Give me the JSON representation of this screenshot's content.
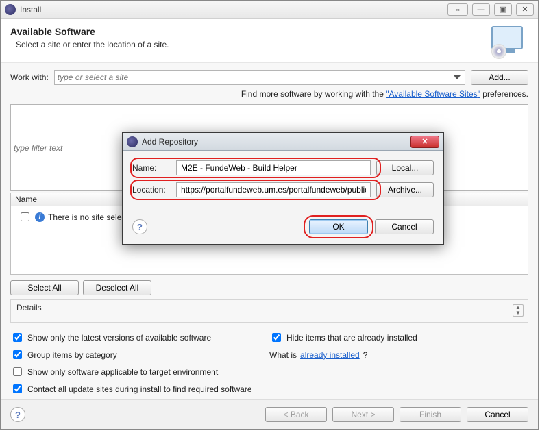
{
  "window": {
    "title": "Install",
    "controls": {
      "detach": "⇔",
      "min": "—",
      "max": "▣",
      "close": "✕"
    }
  },
  "header": {
    "title": "Available Software",
    "subtitle": "Select a site or enter the location of a site."
  },
  "workwith": {
    "label": "Work with:",
    "placeholder": "type or select a site",
    "add_label": "Add..."
  },
  "hint": {
    "prefix": "Find more software by working with the ",
    "link": "Available Software Sites",
    "suffix": " preferences."
  },
  "filter_placeholder": "type filter text",
  "tree": {
    "column": "Name",
    "empty_msg": "There is no site selected."
  },
  "tree_buttons": {
    "select_all": "Select All",
    "deselect_all": "Deselect All"
  },
  "details_label": "Details",
  "options": {
    "latest": "Show only the latest versions of available software",
    "hide_installed": "Hide items that are already installed",
    "group": "Group items by category",
    "whatis_prefix": "What is ",
    "whatis_link": "already installed",
    "applicable": "Show only software applicable to target environment",
    "contact_all": "Contact all update sites during install to find required software"
  },
  "option_states": {
    "latest": true,
    "hide_installed": true,
    "group": true,
    "applicable": false,
    "contact_all": true
  },
  "wizard": {
    "back": "< Back",
    "next": "Next >",
    "finish": "Finish",
    "cancel": "Cancel"
  },
  "modal": {
    "title": "Add Repository",
    "name_label": "Name:",
    "name_value": "M2E - FundeWeb - Build Helper",
    "local_btn": "Local...",
    "location_label": "Location:",
    "location_value": "https://portalfundeweb.um.es/portalfundeweb/public/ec",
    "archive_btn": "Archive...",
    "ok": "OK",
    "cancel": "Cancel"
  }
}
